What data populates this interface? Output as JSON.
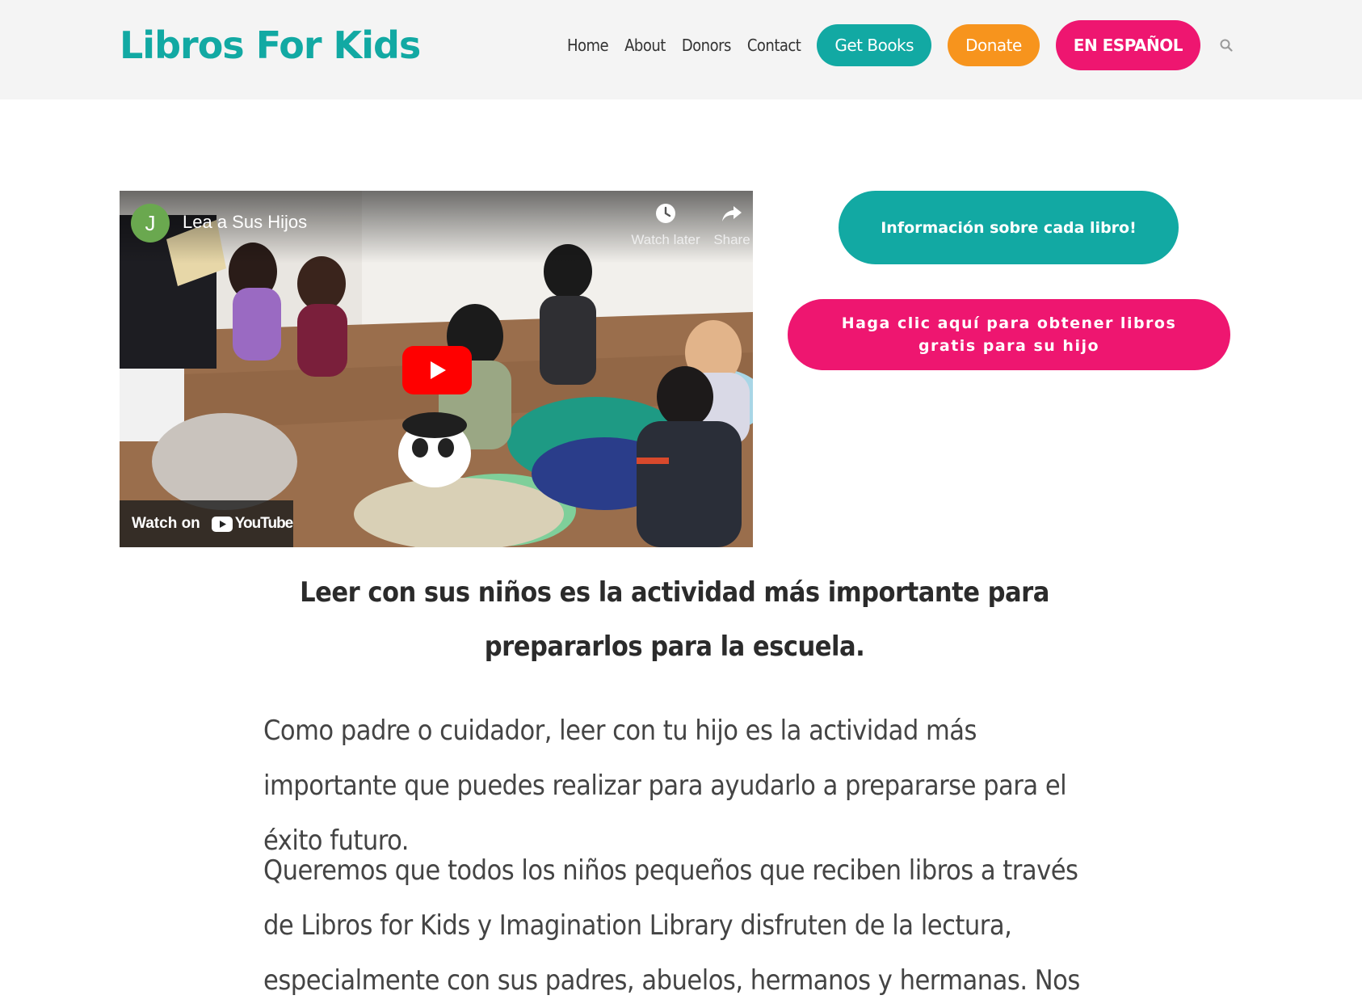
{
  "site": {
    "logo": "Libros For Kids"
  },
  "nav": {
    "links": [
      "Home",
      "About",
      "Donors",
      "Contact"
    ],
    "get_books": "Get Books",
    "donate": "Donate",
    "espanol": "EN ESPAÑOL"
  },
  "video": {
    "channel_initial": "J",
    "title": "Lea a Sus Hijos",
    "watch_later": "Watch later",
    "share": "Share",
    "watch_on": "Watch on",
    "youtube": "YouTube"
  },
  "cta": {
    "info": "Información sobre cada libro!",
    "free_books": "Haga clic aquí para obtener libros gratis para su hijo"
  },
  "content": {
    "headline": "Leer con sus niños es la actividad más importante para prepararlos para la escuela.",
    "paragraph_1": "Como padre o cuidador, leer con tu hijo es la actividad más importante que puedes realizar para ayudarlo a prepararse para el éxito futuro.",
    "paragraph_2": "Queremos que todos los niños pequeños que reciben libros a través de Libros for Kids y Imagination Library disfruten de la lectura, especialmente con sus padres, abuelos, hermanos y hermanas. Nos"
  },
  "colors": {
    "teal": "#12a9a3",
    "orange": "#f7941d",
    "pink": "#ee1670"
  }
}
